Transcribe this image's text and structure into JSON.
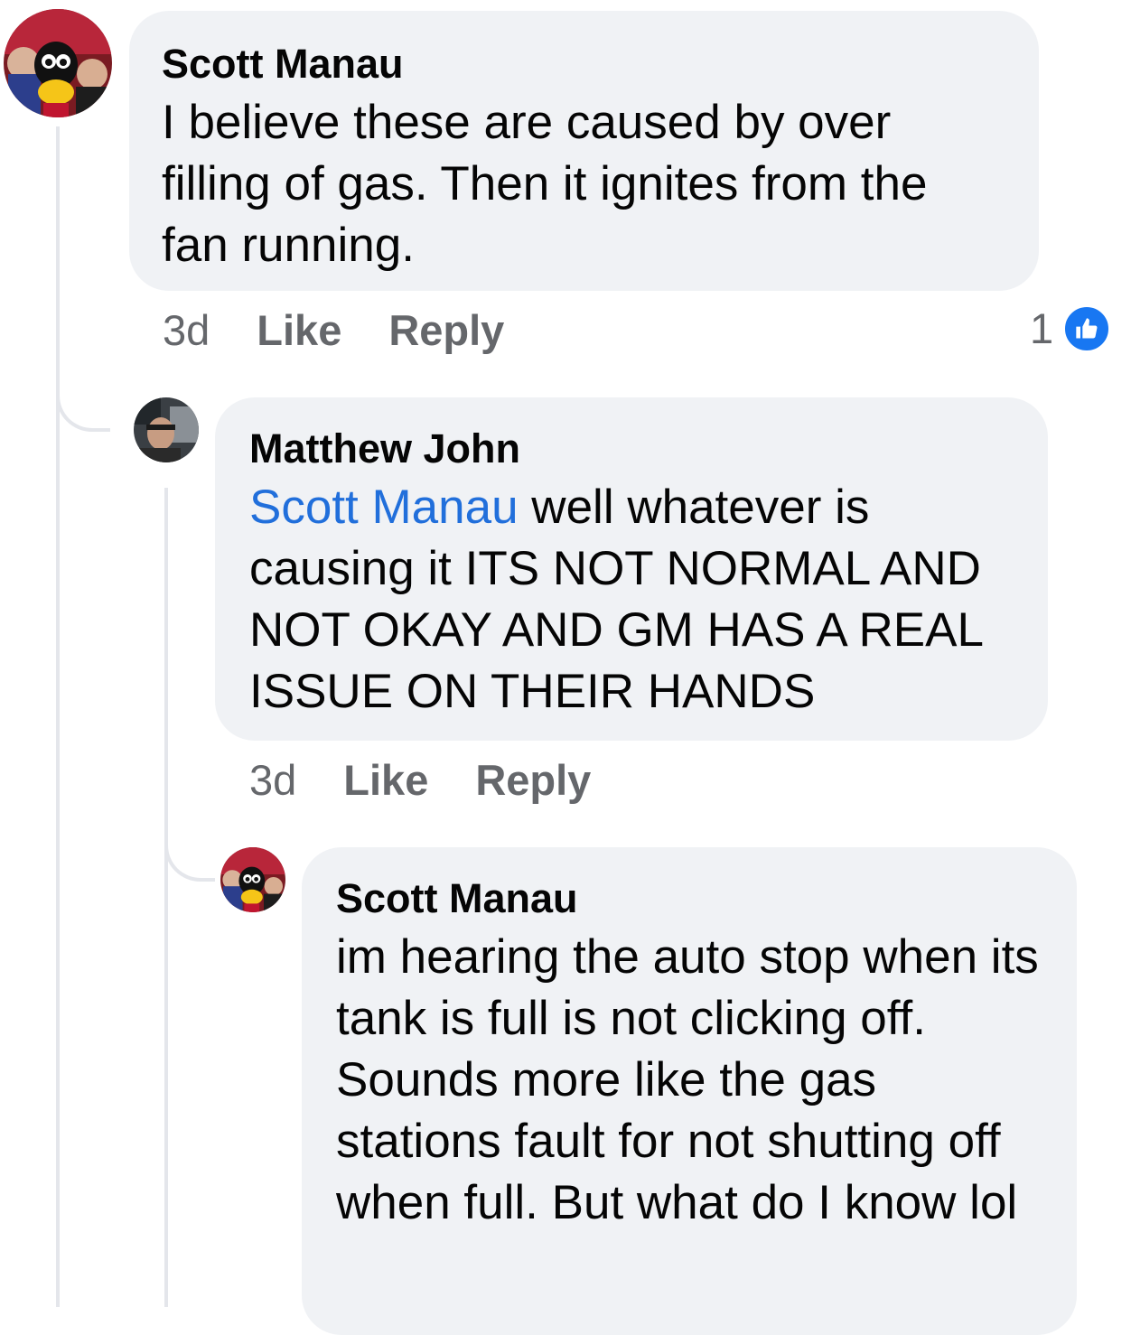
{
  "comments": [
    {
      "author": "Scott Manau",
      "text": "I believe these are caused by over filling of gas.  Then it ignites from the fan running.",
      "time": "3d",
      "like_label": "Like",
      "reply_label": "Reply",
      "reaction_count": "1",
      "reaction_icon": "like-thumbs-up-icon"
    },
    {
      "author": "Matthew John",
      "mention": "Scott Manau",
      "text": " well whatever is causing it ITS NOT NORMAL AND NOT OKAY AND GM HAS A REAL ISSUE ON THEIR HANDS",
      "time": "3d",
      "like_label": "Like",
      "reply_label": "Reply"
    },
    {
      "author": "Scott Manau",
      "text": "im hearing the auto stop when its tank is full is not clicking off.  Sounds more like the gas stations fault for not shutting off when full.  But what do I know lol"
    }
  ],
  "colors": {
    "bubble": "#f0f2f5",
    "mention": "#216fdb",
    "meta": "#65676b",
    "like_blue": "#1877f2",
    "thread_line": "#e4e6eb"
  }
}
